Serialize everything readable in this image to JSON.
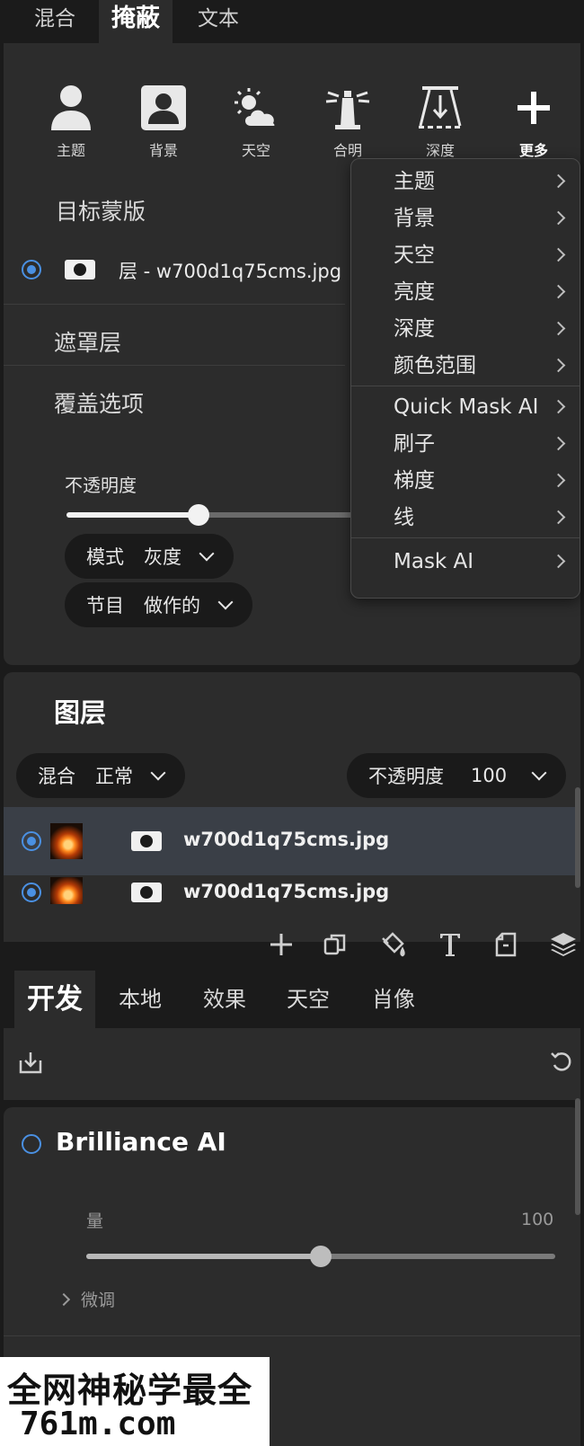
{
  "top_tabs": [
    "混合",
    "掩蔽",
    "文本"
  ],
  "mask_tools": [
    {
      "label": "主题",
      "icon": "person-icon"
    },
    {
      "label": "背景",
      "icon": "person-background-icon"
    },
    {
      "label": "天空",
      "icon": "sun-cloud-icon"
    },
    {
      "label": "合明",
      "icon": "lighthouse-icon"
    },
    {
      "label": "深度",
      "icon": "depth-icon"
    },
    {
      "label": "更多",
      "icon": "plus-icon"
    }
  ],
  "target_mask": {
    "title": "目标蒙版",
    "layer_label": "层 - w700d1q75cms.jpg"
  },
  "mask_layer_title": "遮罩层",
  "overlay": {
    "title": "覆盖选项",
    "opacity_label": "不透明度",
    "opacity_fraction": 0.46,
    "mode_label": "模式",
    "mode_value": "灰度",
    "program_label": "节目",
    "program_value": "做作的"
  },
  "more_menu": {
    "group1": [
      "主题",
      "背景",
      "天空",
      "亮度",
      "深度",
      "颜色范围"
    ],
    "group2": [
      "Quick Mask AI",
      "刷子",
      "梯度",
      "线"
    ],
    "group3": [
      "Mask AI"
    ]
  },
  "layers": {
    "title": "图层",
    "blend_label": "混合",
    "blend_value": "正常",
    "opacity_label": "不透明度",
    "opacity_value": "100",
    "rows": [
      {
        "name": "w700d1q75cms.jpg"
      },
      {
        "name": "w700d1q75cms.jpg"
      }
    ]
  },
  "dev_tabs": [
    "开发",
    "本地",
    "效果",
    "天空",
    "肖像"
  ],
  "brilliance": {
    "title": "Brilliance AI",
    "amount_label": "量",
    "amount_value": "100",
    "amount_fraction": 0.5,
    "fine_tune_label": "微调"
  },
  "watermark": {
    "line1": "全网神秘学最全",
    "line2": "761m.com"
  },
  "colors": {
    "accent": "#4a90e2",
    "panel": "#2c2c2c",
    "background": "#1b1b1b"
  }
}
